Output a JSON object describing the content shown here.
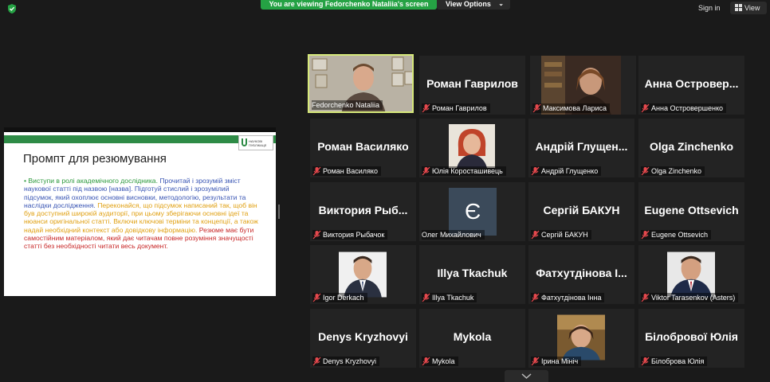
{
  "top_bar": {
    "shield_icon": "shield-check-icon",
    "viewing_text": "You are viewing Fedorchenko Nataliia's screen",
    "view_options_label": "View Options",
    "sign_in_label": "Sign in",
    "view_label": "View",
    "accent_color": "#25a244"
  },
  "shared_slide": {
    "title": "Промпт для резюмування",
    "logo_lines": [
      "НАУКОВІ",
      "ПУБЛІКАЦІЇ"
    ],
    "bullet_green": "Виступи в ролі академічного дослідника.",
    "bullet_blue": " Прочитай і зрозумій зміст наукової статті під назвою [назва]. Підготуй стислий і зрозумілий підсумок, який охоплює основні висновки, методологію, результати та наслідки дослідження.",
    "bullet_orange": " Переконайся, що підсумок написаний так, щоб він був доступний широкій аудиторії, при цьому зберігаючи основні ідеї та нюанси оригінальної статті. Включи ключові терміни та концепції, а також надай необхідний контекст або довідкову інформацію.",
    "bullet_red": " Резюме має бути самостійним матеріалом, який дає читачам повне розуміння значущості статті без необхідності читати весь документ."
  },
  "participants": [
    {
      "display_name": "",
      "label": "Fedorchenko Nataliia",
      "muted": false,
      "video": "webcam",
      "active": true
    },
    {
      "display_name": "Роман Гаврилов",
      "label": "Роман Гаврилов",
      "muted": true,
      "video": "none",
      "active": false
    },
    {
      "display_name": "",
      "label": "Максимова Лариса",
      "muted": true,
      "video": "webcam",
      "active": false
    },
    {
      "display_name": "Анна Островер...",
      "label": "Анна Островершенко",
      "muted": true,
      "video": "none",
      "active": false
    },
    {
      "display_name": "Роман Василяко",
      "label": "Роман Василяко",
      "muted": true,
      "video": "none",
      "active": false
    },
    {
      "display_name": "",
      "label": "Юлія Короcташивець",
      "muted": true,
      "video": "photo",
      "active": false
    },
    {
      "display_name": "Андрій Глущен...",
      "label": "Андрій Глущенко",
      "muted": true,
      "video": "none",
      "active": false
    },
    {
      "display_name": "Olga Zinchenko",
      "label": "Olga Zinchenko",
      "muted": true,
      "video": "none",
      "active": false
    },
    {
      "display_name": "Виктория Рыб...",
      "label": "Виктория Рыбачок",
      "muted": true,
      "video": "none",
      "active": false
    },
    {
      "display_name": "Є",
      "label": "Олег Михайлович",
      "muted": false,
      "video": "letter",
      "active": false
    },
    {
      "display_name": "Сергій БАКУН",
      "label": "Сергій БАКУН",
      "muted": true,
      "video": "none",
      "active": false
    },
    {
      "display_name": "Eugene Ottsevich",
      "label": "Eugene Ottsevich",
      "muted": true,
      "video": "none",
      "active": false
    },
    {
      "display_name": "",
      "label": "Igor Derkach",
      "muted": true,
      "video": "photo",
      "active": false
    },
    {
      "display_name": "Illya Tkachuk",
      "label": "Illya Tkachuk",
      "muted": true,
      "video": "none",
      "active": false
    },
    {
      "display_name": "Фатхутдінова І...",
      "label": "Фатхутдінова Інна",
      "muted": true,
      "video": "none",
      "active": false
    },
    {
      "display_name": "",
      "label": "Viktor Tarasenkov (Asters)",
      "muted": true,
      "video": "photo",
      "active": false
    },
    {
      "display_name": "Denys Kryzhovyi",
      "label": "Denys Kryzhovyi",
      "muted": true,
      "video": "none",
      "active": false
    },
    {
      "display_name": "Mykola",
      "label": "Mykola",
      "muted": true,
      "video": "none",
      "active": false
    },
    {
      "display_name": "",
      "label": "Ірина Мініч",
      "muted": true,
      "video": "photo",
      "active": false
    },
    {
      "display_name": "Білобрової Юлія",
      "label": "Білоброва Юлія",
      "muted": true,
      "video": "none",
      "active": false
    }
  ]
}
